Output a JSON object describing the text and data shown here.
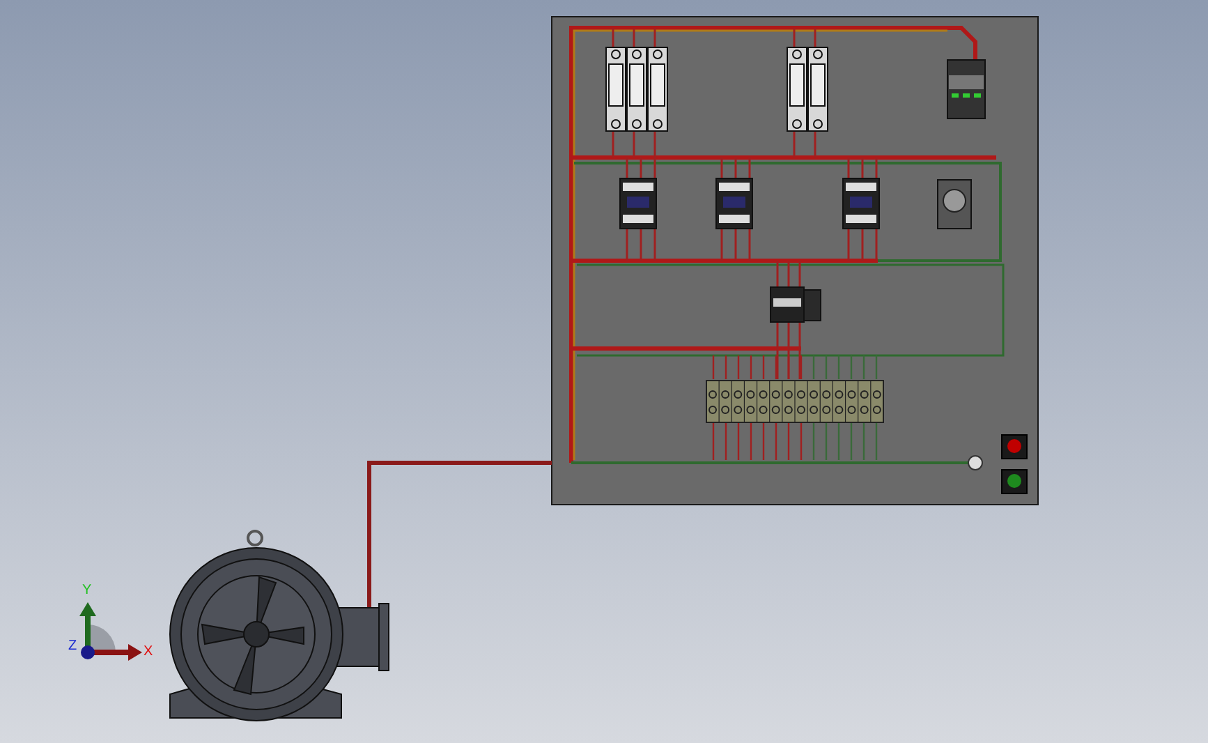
{
  "viewport": {
    "triad": {
      "axes": [
        {
          "label": "X"
        },
        {
          "label": "Y"
        },
        {
          "label": "Z"
        }
      ]
    }
  },
  "panel": {
    "indicator_lights": [
      {
        "color": "#c00000"
      },
      {
        "color": "#1e8a1e"
      }
    ]
  }
}
